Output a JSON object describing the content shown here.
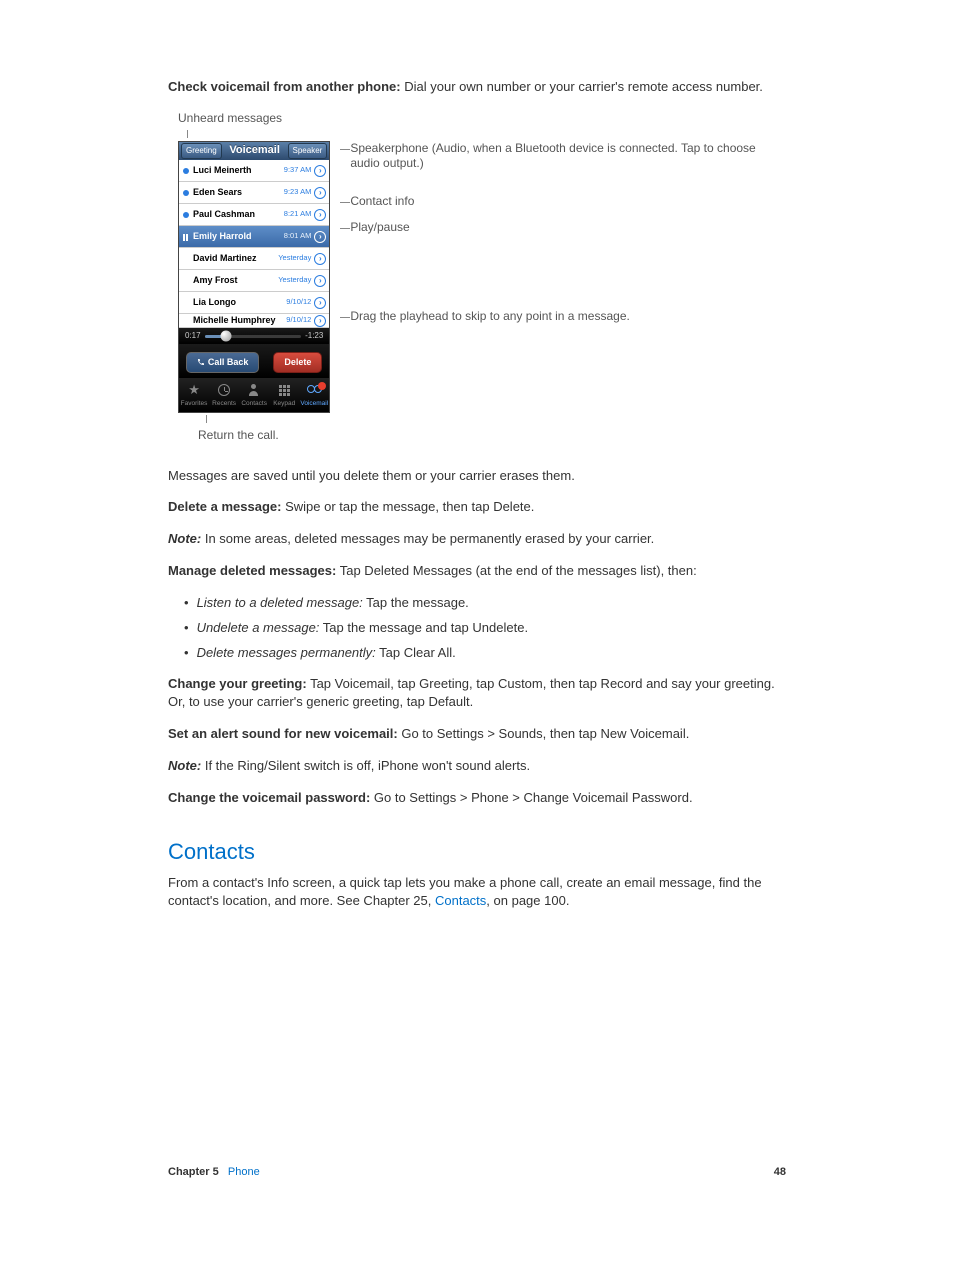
{
  "intro": {
    "check_label": "Check voicemail from another phone:",
    "check_text": "  Dial your own number or your carrier's remote access number."
  },
  "figure": {
    "caption_top": "Unheard messages",
    "caption_bottom": "Return the call.",
    "topbar": {
      "greeting": "Greeting",
      "title": "Voicemail",
      "speaker": "Speaker"
    },
    "messages": [
      {
        "name": "Luci Meinerth",
        "time": "9:37 AM",
        "unread": true
      },
      {
        "name": "Eden Sears",
        "time": "9:23 AM",
        "unread": true
      },
      {
        "name": "Paul Cashman",
        "time": "8:21 AM",
        "unread": true
      },
      {
        "name": "Emily Harrold",
        "time": "8:01 AM",
        "selected": true,
        "pause": true
      },
      {
        "name": "David Martinez",
        "time": "Yesterday"
      },
      {
        "name": "Amy Frost",
        "time": "Yesterday"
      },
      {
        "name": "Lia Longo",
        "time": "9/10/12"
      },
      {
        "name": "Michelle Humphrey",
        "time": "9/10/12",
        "partial": true
      }
    ],
    "scrub": {
      "elapsed": "0:17",
      "remaining": "-1:23"
    },
    "buttons": {
      "callback": "Call Back",
      "delete": "Delete"
    },
    "tabs": {
      "favorites": "Favorites",
      "recents": "Recents",
      "contacts": "Contacts",
      "keypad": "Keypad",
      "voicemail": "Voicemail"
    },
    "callouts": {
      "speakerphone": "Speakerphone (Audio, when a Bluetooth device is connected. Tap to choose audio output.)",
      "contact_info": "Contact info",
      "play_pause": "Play/pause",
      "playhead": "Drag the playhead to skip to any point in a message."
    }
  },
  "body": {
    "p_saved": "Messages are saved until you delete them or your carrier erases them.",
    "delete_label": "Delete a message:",
    "delete_text": "  Swipe or tap the message, then tap Delete.",
    "note1_label": "Note:",
    "note1_text": "  In some areas, deleted messages may be permanently erased by your carrier.",
    "manage_label": "Manage deleted messages:",
    "manage_text": "  Tap Deleted Messages (at the end of the messages list), then:",
    "li1_label": "Listen to a deleted message:",
    "li1_text": "  Tap the message.",
    "li2_label": "Undelete a message:",
    "li2_text": "  Tap the message and tap Undelete.",
    "li3_label": "Delete messages permanently:",
    "li3_text": "  Tap Clear All.",
    "greeting_label": "Change your greeting:",
    "greeting_text": "  Tap Voicemail, tap Greeting, tap Custom, then tap Record and say your greeting. Or, to use your carrier's generic greeting, tap Default.",
    "alert_label": "Set an alert sound for new voicemail:",
    "alert_text": "  Go to Settings > Sounds, then tap New Voicemail.",
    "note2_label": "Note:",
    "note2_text": "  If the Ring/Silent switch is off, iPhone won't sound alerts.",
    "pwd_label": "Change the voicemail password:",
    "pwd_text": "  Go to Settings > Phone > Change Voicemail Password."
  },
  "contacts_section": {
    "heading": "Contacts",
    "text_before": "From a contact's Info screen, a quick tap lets you make a phone call, create an email message, find the contact's location, and more. See Chapter 25, ",
    "link": "Contacts",
    "text_after": ", on page 100."
  },
  "footer": {
    "chapter_label": "Chapter  5",
    "chapter_name": "Phone",
    "page": "48"
  }
}
